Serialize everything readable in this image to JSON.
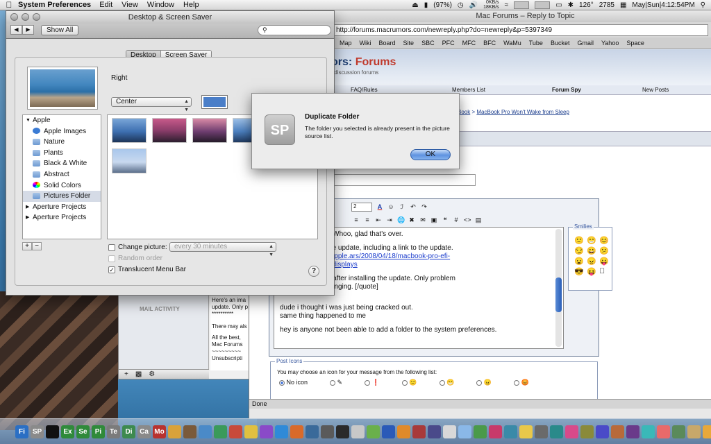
{
  "menubar": {
    "app_name": "System Preferences",
    "menus": [
      "Edit",
      "View",
      "Window",
      "Help"
    ],
    "battery": "(97%)",
    "net_up": "0KB/s",
    "net_down": "18KB/s",
    "temperature": "126°",
    "fan_rpm": "2785",
    "datetime": "May|Sun|4:12:54PM"
  },
  "browser": {
    "title": "Mac Forums – Reply to Topic",
    "url": "http://forums.macrumors.com/newreply.php?do=newreply&p=5397349",
    "bookmarks": [
      "Map",
      "Wiki",
      "Board",
      "Site",
      "SBC",
      "PFC",
      "MFC",
      "BFC",
      "WaMu",
      "Tube",
      "Bucket",
      "Gmail",
      "Yahoo",
      "Space"
    ],
    "forum_title_a": "ors:",
    "forum_title_b": "Forums",
    "forum_sub": "y discussion forums",
    "nav": [
      "FAQ/Rules",
      "Members List",
      "Forum Spy",
      "New Posts"
    ],
    "breadcrumb_prefix": "Book",
    "breadcrumb_sep": ">",
    "breadcrumb_link": "MacBook Pro Won't Wake from Sleep",
    "font_size": "2",
    "smilies_label": "Smilies",
    "post_lines": [
      "ew sleep issues. Whoo, glad that's over.",
      "sting article on the update, including a link to the update.",
      "ca.com/journals/apple.ars/2008/04/18/macbook-pro-efi-",
      "ly-causing-blank-displays",
      "k have problems after installing the update. Only problem",
      "shop defaults changing. [/quote]",
      "dude i thought i was just being cracked out.",
      "same thing happened to me",
      "hey is anyone not been able to add a folder to the system preferences."
    ],
    "post_icons_label": "Post Icons",
    "post_icons_desc": "You may choose an icon for your message from the following list:",
    "no_icon_label": "No icon",
    "status": "Done"
  },
  "mail": {
    "activity_label": "MAIL ACTIVITY",
    "body_lines": [
      "Here's an ima",
      "update. Only p",
      "**********",
      "There may als",
      "All the best,",
      "Mac Forums",
      "~~~~~~~~~",
      "Unsubscripti"
    ]
  },
  "syspref": {
    "title": "Desktop & Screen Saver",
    "show_all": "Show All",
    "tabs": [
      "Desktop",
      "Screen Saver"
    ],
    "picture_name": "Right",
    "fit_option": "Center",
    "source_list": [
      {
        "label": "Apple",
        "type": "group"
      },
      {
        "label": "Apple Images",
        "type": "apple"
      },
      {
        "label": "Nature",
        "type": "folder"
      },
      {
        "label": "Plants",
        "type": "folder"
      },
      {
        "label": "Black & White",
        "type": "folder"
      },
      {
        "label": "Abstract",
        "type": "folder"
      },
      {
        "label": "Solid Colors",
        "type": "colors"
      },
      {
        "label": "Pictures Folder",
        "type": "folder",
        "selected": true
      },
      {
        "label": "Aperture Projects",
        "type": "group-collapsed"
      },
      {
        "label": "Aperture Projects",
        "type": "group-collapsed"
      }
    ],
    "change_picture_label": "Change picture:",
    "change_interval": "every 30 minutes",
    "random_order_label": "Random order",
    "translucent_label": "Translucent Menu Bar",
    "translucent_checked": true,
    "swatch_color": "#4a7ec8"
  },
  "dialog": {
    "icon_text": "SP",
    "title": "Duplicate Folder",
    "message": "The folder you selected is already present in the picture source list.",
    "ok_label": "OK"
  },
  "dock": {
    "items": [
      {
        "label": "Fi",
        "color": "#2a6fc4"
      },
      {
        "label": "SP",
        "color": "#8a8a8a"
      },
      {
        "label": "",
        "color": "#111"
      },
      {
        "label": "Ex",
        "color": "#2f8a3a"
      },
      {
        "label": "Se",
        "color": "#2f8a3a"
      },
      {
        "label": "Pi",
        "color": "#2f8a3a"
      },
      {
        "label": "Te",
        "color": "#7b7b7b"
      },
      {
        "label": "Di",
        "color": "#3d8a4f"
      },
      {
        "label": "Ca",
        "color": "#8a8a8a"
      },
      {
        "label": "Mo",
        "color": "#b8322f"
      }
    ]
  }
}
